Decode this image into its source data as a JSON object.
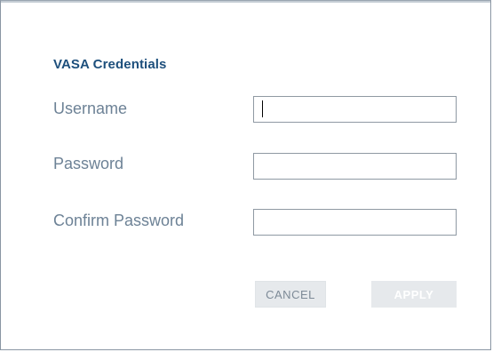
{
  "dialog": {
    "section_title": "VASA Credentials",
    "fields": {
      "username": {
        "label": "Username",
        "value": "",
        "placeholder": ""
      },
      "password": {
        "label": "Password",
        "value": "",
        "placeholder": ""
      },
      "confirm_password": {
        "label": "Confirm Password",
        "value": "",
        "placeholder": ""
      }
    },
    "buttons": {
      "cancel_label": "CANCEL",
      "apply_label": "APPLY"
    }
  },
  "colors": {
    "title": "#1d4f7c",
    "label": "#6d8296",
    "button_bg": "#e6e9ec",
    "input_border": "#8f99a3"
  }
}
